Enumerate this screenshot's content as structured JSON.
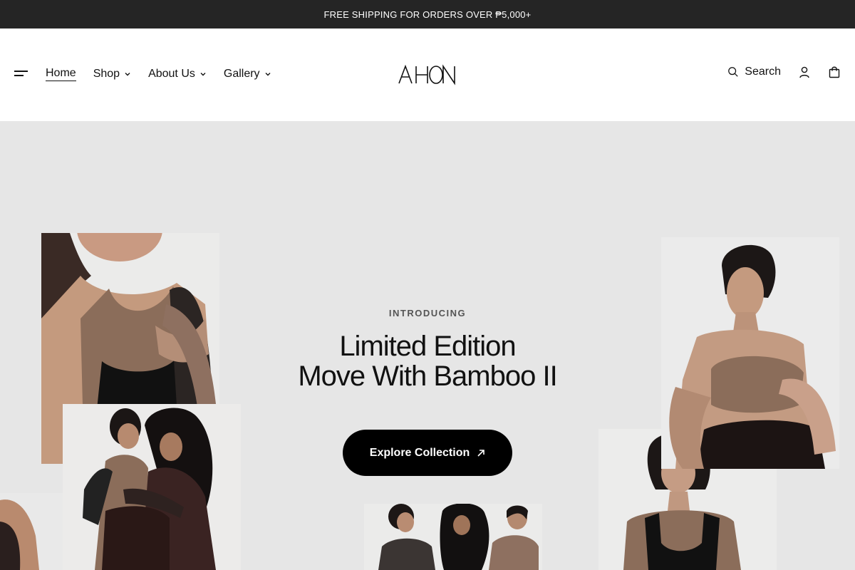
{
  "announcement": {
    "text": "FREE SHIPPING FOR ORDERS OVER ₱5,000+"
  },
  "header": {
    "nav": [
      {
        "label": "Home",
        "active": true
      },
      {
        "label": "Shop",
        "has_dropdown": true
      },
      {
        "label": "About Us",
        "has_dropdown": true
      },
      {
        "label": "Gallery",
        "has_dropdown": true
      }
    ],
    "logo": "AHON",
    "search_label": "Search",
    "icons": [
      "menu-icon",
      "search-icon",
      "account-icon",
      "cart-icon"
    ]
  },
  "hero": {
    "eyebrow": "INTRODUCING",
    "title_line1": "Limited Edition",
    "title_line2": "Move With Bamboo II",
    "cta_label": "Explore Collection",
    "cta_icon": "arrow-up-right-icon"
  },
  "colors": {
    "announcement_bg": "#252525",
    "hero_bg": "#e6e6e6",
    "cta_bg": "#000000",
    "skin": "#c9a48a",
    "mocha": "#8b6d5a"
  }
}
